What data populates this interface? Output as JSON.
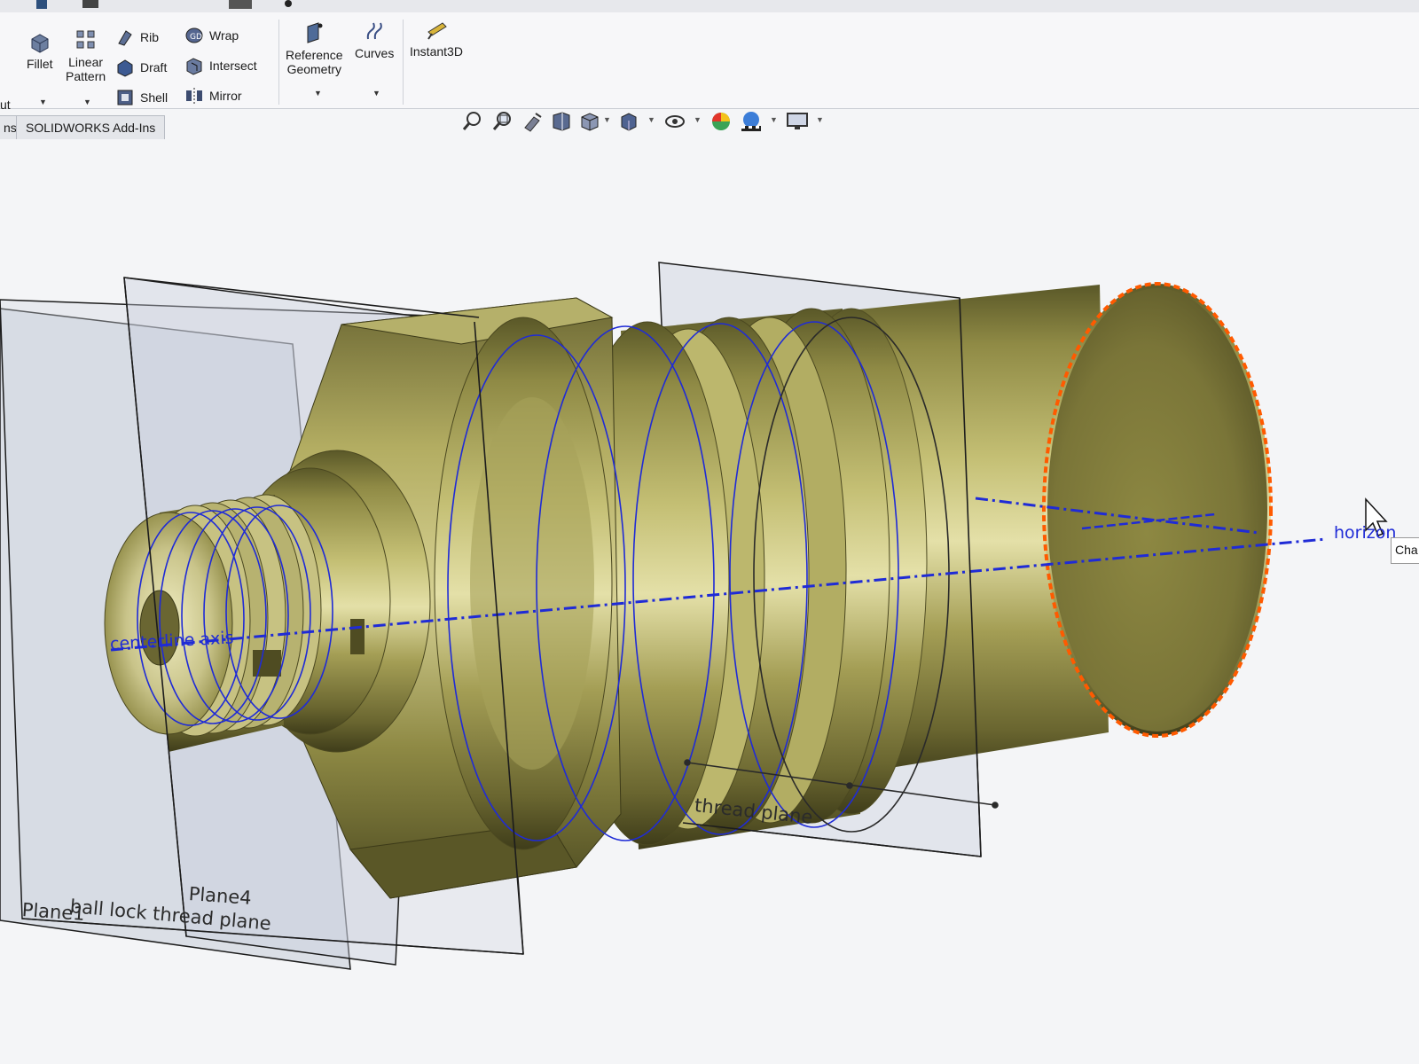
{
  "ribbon": {
    "cut_label": "ut",
    "fillet": "Fillet",
    "linear_pattern": "Linear\nPattern",
    "rib": "Rib",
    "draft": "Draft",
    "shell": "Shell",
    "wrap": "Wrap",
    "intersect": "Intersect",
    "mirror": "Mirror",
    "reference_geometry": "Reference\nGeometry",
    "curves": "Curves",
    "instant3d": "Instant3D"
  },
  "tabs": [
    {
      "label": "ns"
    },
    {
      "label": "SOLIDWORKS Add-Ins"
    }
  ],
  "viewport": {
    "sketch_labels": {
      "centerline": "centerline axis",
      "horizontal": "horizon"
    },
    "plane_labels": {
      "plane1": "Plane1",
      "ball_lock": "ball lock thread plane",
      "plane4": "Plane4",
      "thread_plane": "thread plane"
    },
    "tooltip_text": "Cha"
  },
  "colors": {
    "part_body": "#a39d55",
    "part_highlight": "#e6e3b0",
    "part_shadow": "#4d4a22",
    "sketch_blue": "#1f2bd6",
    "selected_edge": "#ff5a00",
    "plane_fill": "#c7ccd8"
  },
  "icons": [
    "fillet-icon",
    "linear-pattern-icon",
    "rib-icon",
    "draft-icon",
    "shell-icon",
    "wrap-icon",
    "intersect-icon",
    "mirror-icon",
    "reference-geometry-icon",
    "curves-icon",
    "instant3d-icon",
    "zoom-to-fit-icon",
    "zoom-to-area-icon",
    "previous-view-icon",
    "section-view-icon",
    "view-orientation-icon",
    "display-style-icon",
    "hide-show-icon",
    "edit-appearance-icon",
    "apply-scene-icon",
    "view-settings-icon"
  ]
}
